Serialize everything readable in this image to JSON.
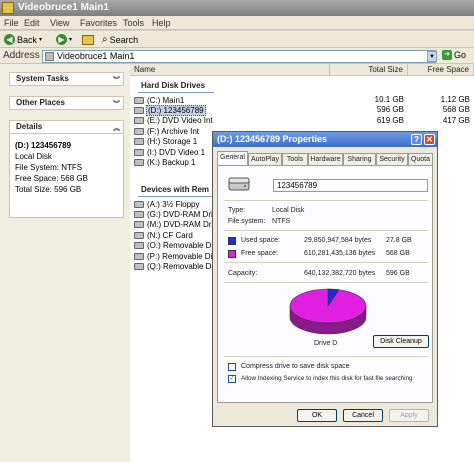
{
  "window": {
    "title": "Videobruce1 Main1"
  },
  "menu": [
    "File",
    "Edit",
    "View",
    "Favorites",
    "Tools",
    "Help"
  ],
  "toolbar": {
    "back": "Back",
    "search": "Search"
  },
  "address": {
    "label": "Address",
    "value": "Videobruce1 Main1",
    "go": "Go"
  },
  "left": {
    "system_tasks": "System Tasks",
    "other_places": "Other Places",
    "details": "Details",
    "detail_title": "(D:) 123456789",
    "detail_type": "Local Disk",
    "detail_fs": "File System: NTFS",
    "detail_free": "Free Space: 568 GB",
    "detail_total": "Total Size: 596 GB"
  },
  "columns": {
    "name": "Name",
    "total": "Total Size",
    "free": "Free Space"
  },
  "hdd_group": "Hard Disk Drives",
  "hdd": [
    {
      "name": "(C:) Main1",
      "total": "10.1 GB",
      "free": "1.12 GB"
    },
    {
      "name": "(D:) 123456789",
      "total": "596 GB",
      "free": "568 GB"
    },
    {
      "name": "(E:) DVD Video Int",
      "total": "619 GB",
      "free": "417 GB"
    },
    {
      "name": "(F:) Archive Int",
      "total": "",
      "free": ""
    },
    {
      "name": "(H:) Storage 1",
      "total": "",
      "free": ""
    },
    {
      "name": "(I:) DVD Video 1",
      "total": "",
      "free": ""
    },
    {
      "name": "(K:) Backup 1",
      "total": "",
      "free": ""
    }
  ],
  "rem_group": "Devices with Rem",
  "rem": [
    {
      "name": "(A:) 3½ Floppy"
    },
    {
      "name": "(G:) DVD-RAM Driv"
    },
    {
      "name": "(M:) DVD-RAM Driv"
    },
    {
      "name": "(N:) CF Card"
    },
    {
      "name": "(O:) Removable Di"
    },
    {
      "name": "(P:) Removable Di"
    },
    {
      "name": "(Q:) Removable Di"
    }
  ],
  "dialog": {
    "title": "(D:) 123456789 Properties",
    "tabs": [
      "General",
      "AutoPlay",
      "Tools",
      "Hardware",
      "Sharing",
      "Security",
      "Quota"
    ],
    "name": "123456789",
    "type_label": "Type:",
    "type_value": "Local Disk",
    "fs_label": "File system:",
    "fs_value": "NTFS",
    "used_label": "Used space:",
    "used_bytes": "29,850,947,584 bytes",
    "used_gb": "27.8 GB",
    "free_label": "Free space:",
    "free_bytes": "610,281,435,136 bytes",
    "free_gb": "568 GB",
    "cap_label": "Capacity:",
    "cap_bytes": "640,132,382,720 bytes",
    "cap_gb": "596 GB",
    "drive_label": "Drive D",
    "cleanup": "Disk Cleanup",
    "compress": "Compress drive to save disk space",
    "index": "Allow Indexing Service to index this disk for fast file searching",
    "ok": "OK",
    "cancel": "Cancel",
    "apply": "Apply",
    "used_color": "#1f2bd8",
    "free_color": "#e020e0",
    "used_fraction": 0.0466,
    "free_fraction": 0.9534
  }
}
